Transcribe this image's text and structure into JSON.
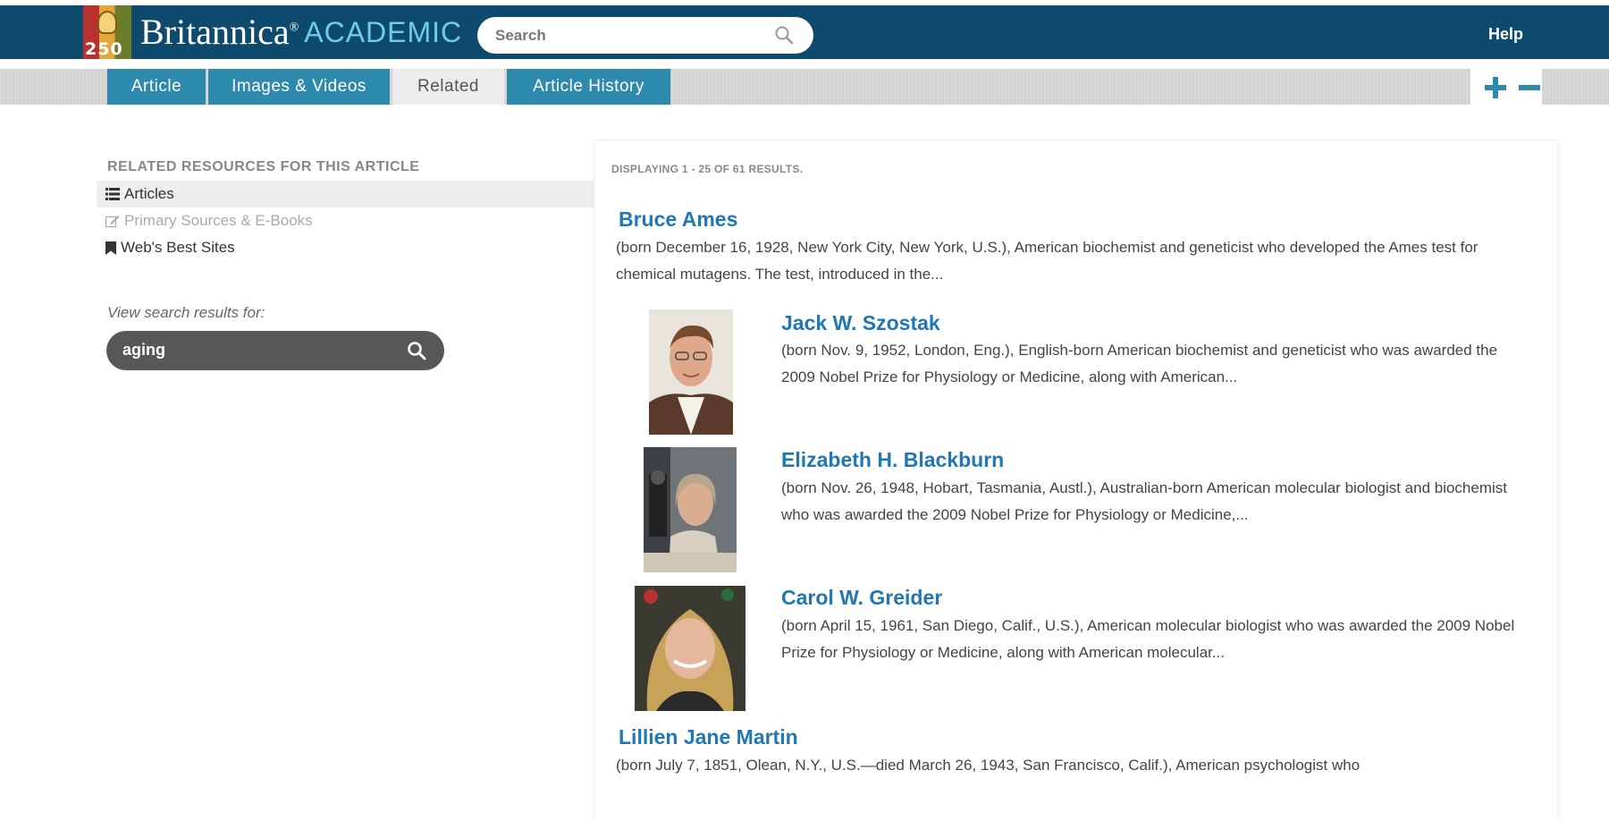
{
  "header": {
    "logo_number": "250",
    "logo_name": "Britannica",
    "logo_mark": "®",
    "logo_sub": "ACADEMIC",
    "search_placeholder": "Search",
    "help": "Help"
  },
  "tabs": [
    {
      "label": "Article",
      "active": false
    },
    {
      "label": "Images & Videos",
      "active": false
    },
    {
      "label": "Related",
      "active": true
    },
    {
      "label": "Article History",
      "active": false
    }
  ],
  "sidebar": {
    "heading": "RELATED RESOURCES FOR THIS ARTICLE",
    "items": [
      {
        "label": "Articles",
        "icon": "list-icon",
        "state": "active"
      },
      {
        "label": "Primary Sources & E-Books",
        "icon": "edit-icon",
        "state": "disabled"
      },
      {
        "label": "Web's Best Sites",
        "icon": "bookmark-icon",
        "state": "normal"
      }
    ],
    "view_label": "View search results for:",
    "search_term": "aging"
  },
  "results": {
    "displaying": "DISPLAYING 1 - 25 OF 61 RESULTS.",
    "items": [
      {
        "title": "Bruce Ames",
        "desc": "(born December 16, 1928, New York City, New York, U.S.), American biochemist and geneticist who developed the Ames test for chemical mutagens. The test, introduced in the..."
      },
      {
        "title": "Jack W. Szostak",
        "desc": "(born Nov. 9, 1952, London, Eng.), English-born American biochemist and geneticist who was awarded the 2009 Nobel Prize for Physiology or Medicine, along with American..."
      },
      {
        "title": "Elizabeth H. Blackburn",
        "desc": "(born Nov. 26, 1948, Hobart, Tasmania, Austl.), Australian-born American molecular biologist and biochemist who was awarded the 2009 Nobel Prize for Physiology or Medicine,..."
      },
      {
        "title": "Carol W. Greider",
        "desc": "(born April 15, 1961, San Diego, Calif., U.S.), American molecular biologist who was awarded the 2009 Nobel Prize for Physiology or Medicine, along with American molecular..."
      },
      {
        "title": "Lillien Jane Martin",
        "desc": "(born July 7, 1851, Olean, N.Y., U.S.—died March 26, 1943, San Francisco, Calif.), American psychologist who"
      }
    ]
  },
  "colors": {
    "header": "#0e4a6e",
    "tab": "#2e8aad",
    "link": "#1f78b4"
  }
}
